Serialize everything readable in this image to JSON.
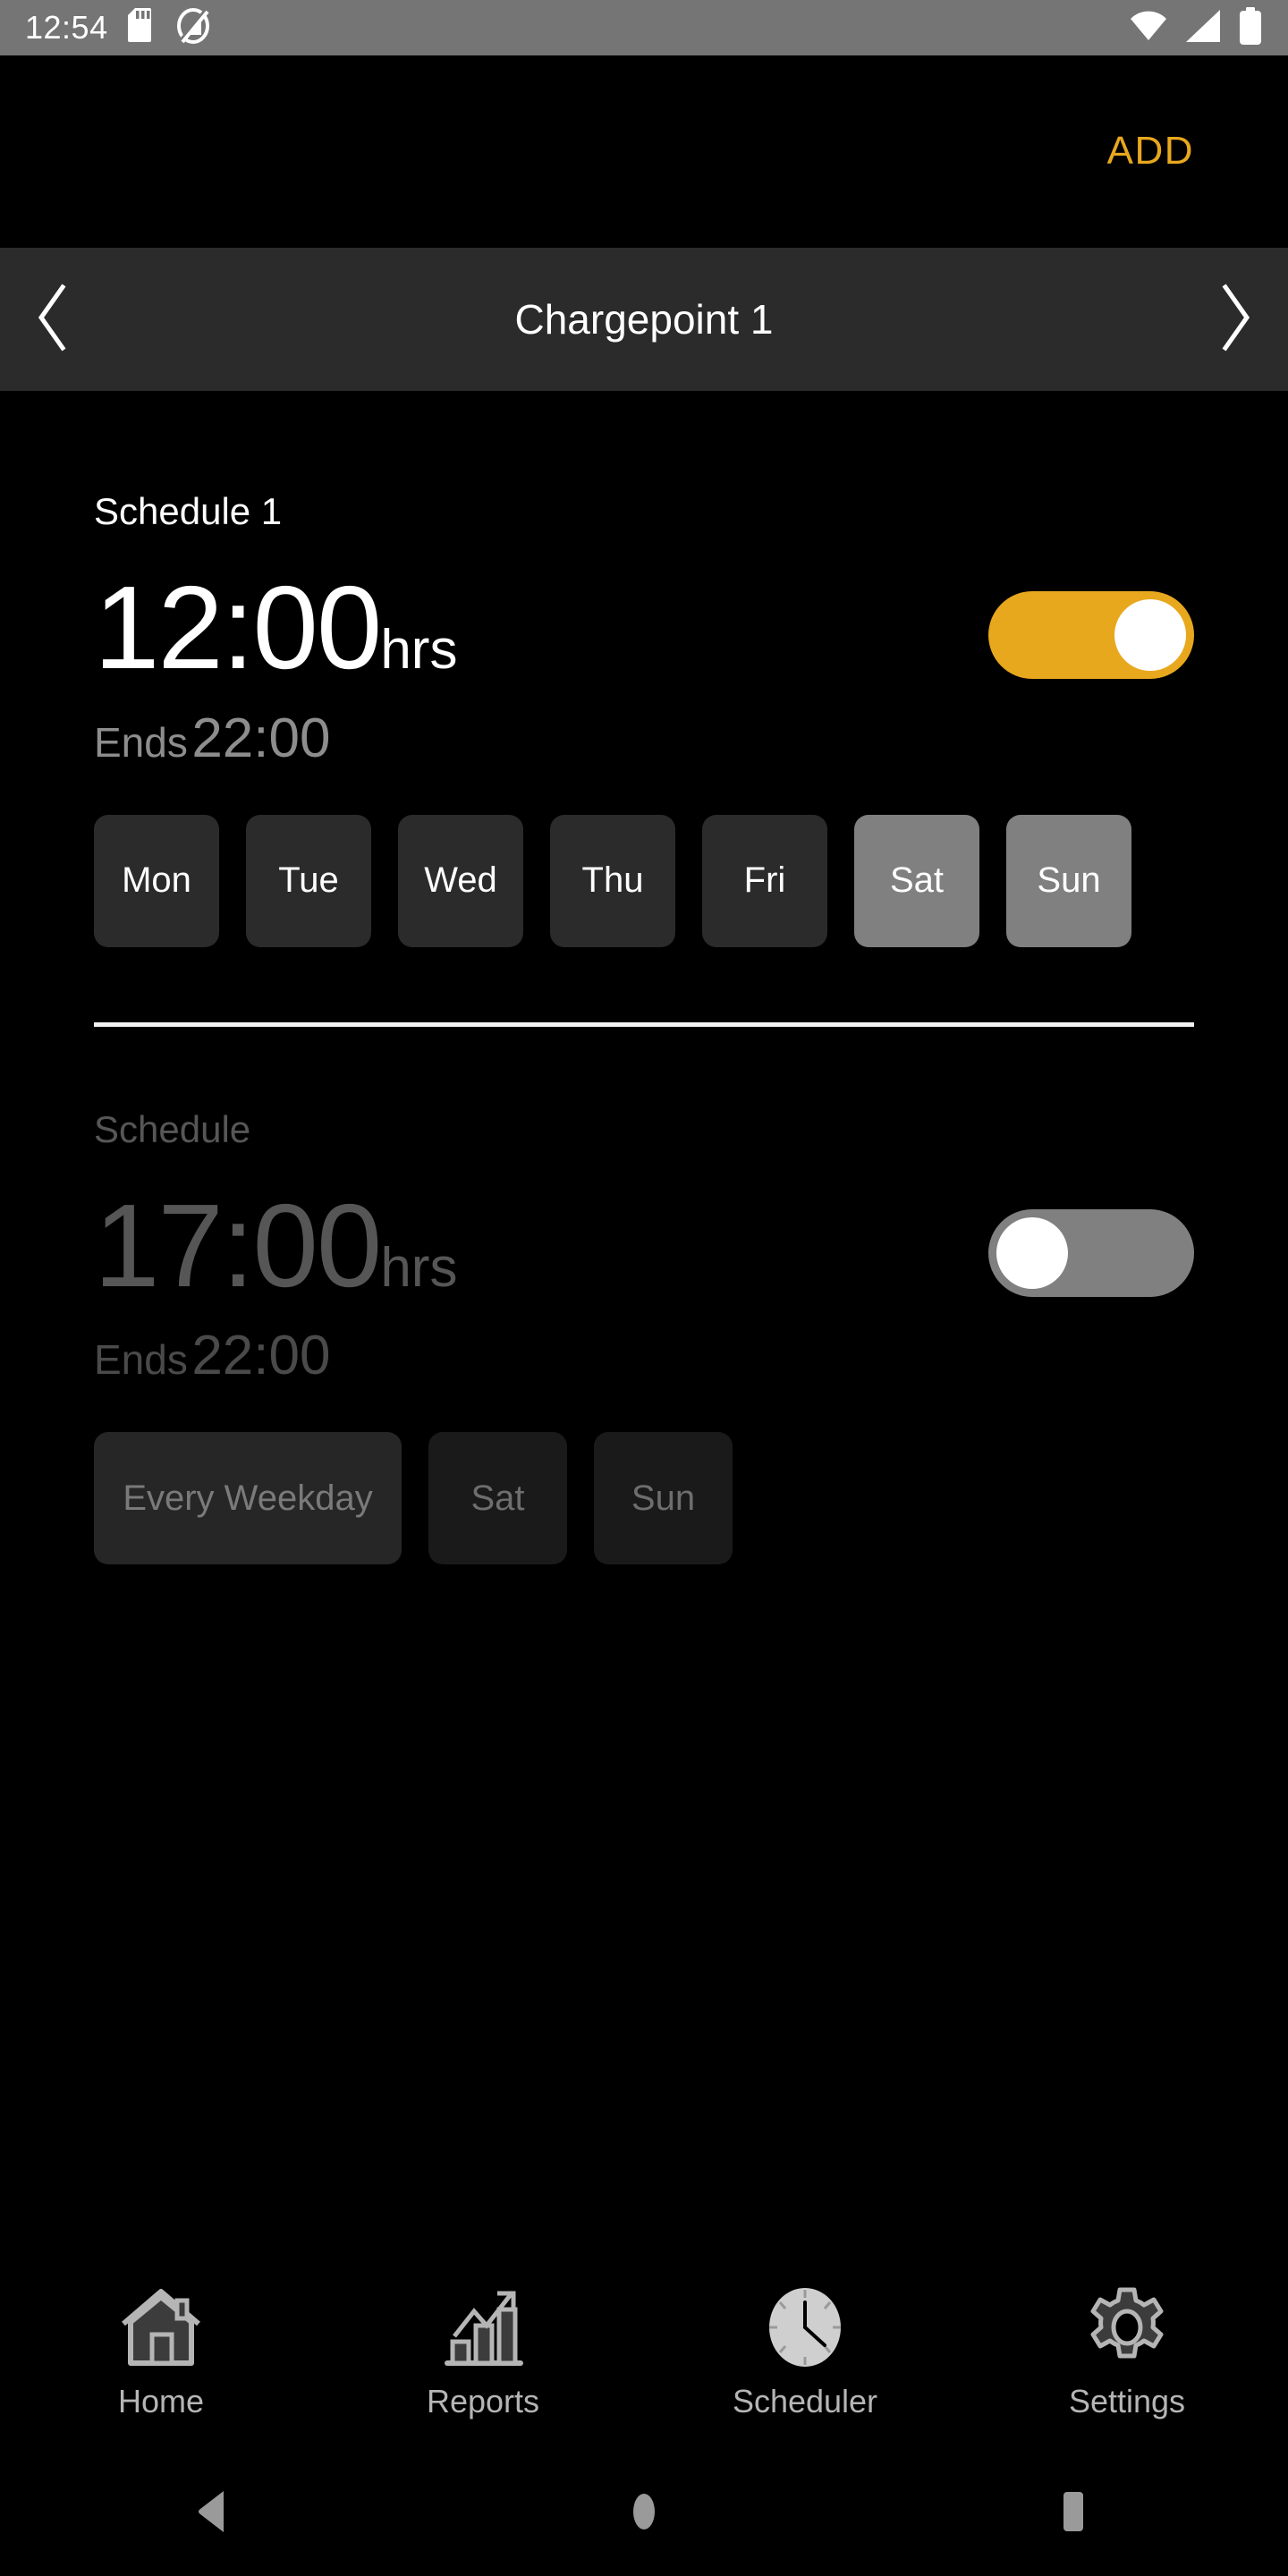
{
  "statusbar": {
    "time": "12:54",
    "icons_left": [
      "sd-card-icon",
      "do-not-disturb-icon"
    ],
    "icons_right": [
      "wifi-icon",
      "cellular-signal-icon",
      "battery-icon"
    ]
  },
  "topbar": {
    "add_label": "ADD",
    "accent_color": "#e8a81e"
  },
  "header": {
    "title": "Chargepoint 1",
    "prev_icon": "chevron-left-icon",
    "next_icon": "chevron-right-icon"
  },
  "schedules": [
    {
      "name": "Schedule 1",
      "time": "12:00",
      "unit": "hrs",
      "ends_label": "Ends",
      "ends_value": "22:00",
      "enabled": true,
      "toggle_state": "on",
      "days": [
        {
          "label": "Mon",
          "selected": false
        },
        {
          "label": "Tue",
          "selected": false
        },
        {
          "label": "Wed",
          "selected": false
        },
        {
          "label": "Thu",
          "selected": false
        },
        {
          "label": "Fri",
          "selected": false
        },
        {
          "label": "Sat",
          "selected": true
        },
        {
          "label": "Sun",
          "selected": true
        }
      ]
    },
    {
      "name": "Schedule",
      "time": "17:00",
      "unit": "hrs",
      "ends_label": "Ends",
      "ends_value": "22:00",
      "enabled": false,
      "toggle_state": "off",
      "days": [
        {
          "label": "Every Weekday",
          "selected": false
        },
        {
          "label": "Sat",
          "selected": false
        },
        {
          "label": "Sun",
          "selected": false
        }
      ]
    }
  ],
  "tabbar": {
    "active": "Scheduler",
    "tabs": [
      {
        "label": "Home",
        "icon": "home-icon"
      },
      {
        "label": "Reports",
        "icon": "bar-chart-arrow-icon"
      },
      {
        "label": "Scheduler",
        "icon": "clock-icon"
      },
      {
        "label": "Settings",
        "icon": "gear-icon"
      }
    ]
  },
  "androidnav": {
    "back": "back-triangle-icon",
    "home": "home-circle-icon",
    "recents": "recents-square-icon"
  }
}
